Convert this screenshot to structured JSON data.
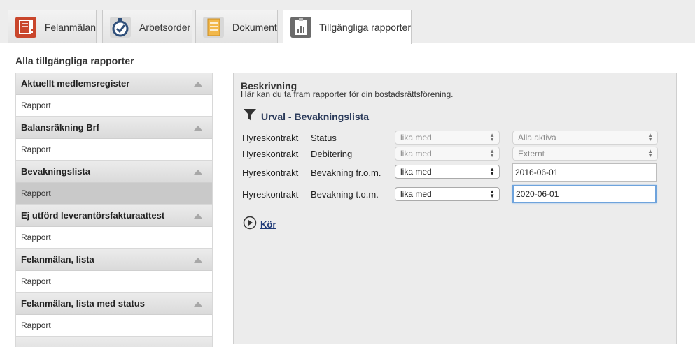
{
  "tabs": [
    {
      "label": "Felanmälan",
      "icon": "report-issue-icon",
      "color": "#c9462c",
      "active": false
    },
    {
      "label": "Arbetsorder",
      "icon": "stopwatch-check-icon",
      "color": "#2f4f7a",
      "active": false
    },
    {
      "label": "Dokument",
      "icon": "document-icon",
      "color": "#e8a63a",
      "active": false
    },
    {
      "label": "Tillgängliga rapporter",
      "icon": "report-chart-icon",
      "color": "#6b6b6b",
      "active": true
    }
  ],
  "page_title": "Alla tillgängliga rapporter",
  "report_groups": [
    {
      "title": "Aktuellt medlemsregister",
      "item": "Rapport",
      "selected": false
    },
    {
      "title": "Balansräkning Brf",
      "item": "Rapport",
      "selected": false
    },
    {
      "title": "Bevakningslista",
      "item": "Rapport",
      "selected": true
    },
    {
      "title": "Ej utförd leverantörsfakturaattest",
      "item": "Rapport",
      "selected": false
    },
    {
      "title": "Felanmälan, lista",
      "item": "Rapport",
      "selected": false
    },
    {
      "title": "Felanmälan, lista med status",
      "item": "Rapport",
      "selected": false
    },
    {
      "title": "",
      "item": "",
      "selected": false
    }
  ],
  "panel": {
    "description_title": "Beskrivning",
    "description_text": "Här kan du ta fram rapporter för din bostadsrättsförening.",
    "selection_title": "Urval - Bevakningslista",
    "filters": [
      {
        "entity": "Hyreskontrakt",
        "field": "Status",
        "operator": "lika med",
        "value": "Alla aktiva",
        "value_type": "select",
        "enabled": false
      },
      {
        "entity": "Hyreskontrakt",
        "field": "Debitering",
        "operator": "lika med",
        "value": "Externt",
        "value_type": "select",
        "enabled": false
      },
      {
        "entity": "Hyreskontrakt",
        "field": "Bevakning fr.o.m.",
        "operator": "lika med",
        "value": "2016-06-01",
        "value_type": "input",
        "enabled": true
      },
      {
        "entity": "Hyreskontrakt",
        "field": "Bevakning t.o.m.",
        "operator": "lika med",
        "value": "2020-06-01",
        "value_type": "input",
        "enabled": true,
        "focused": true
      }
    ],
    "run_label": "Kör"
  }
}
